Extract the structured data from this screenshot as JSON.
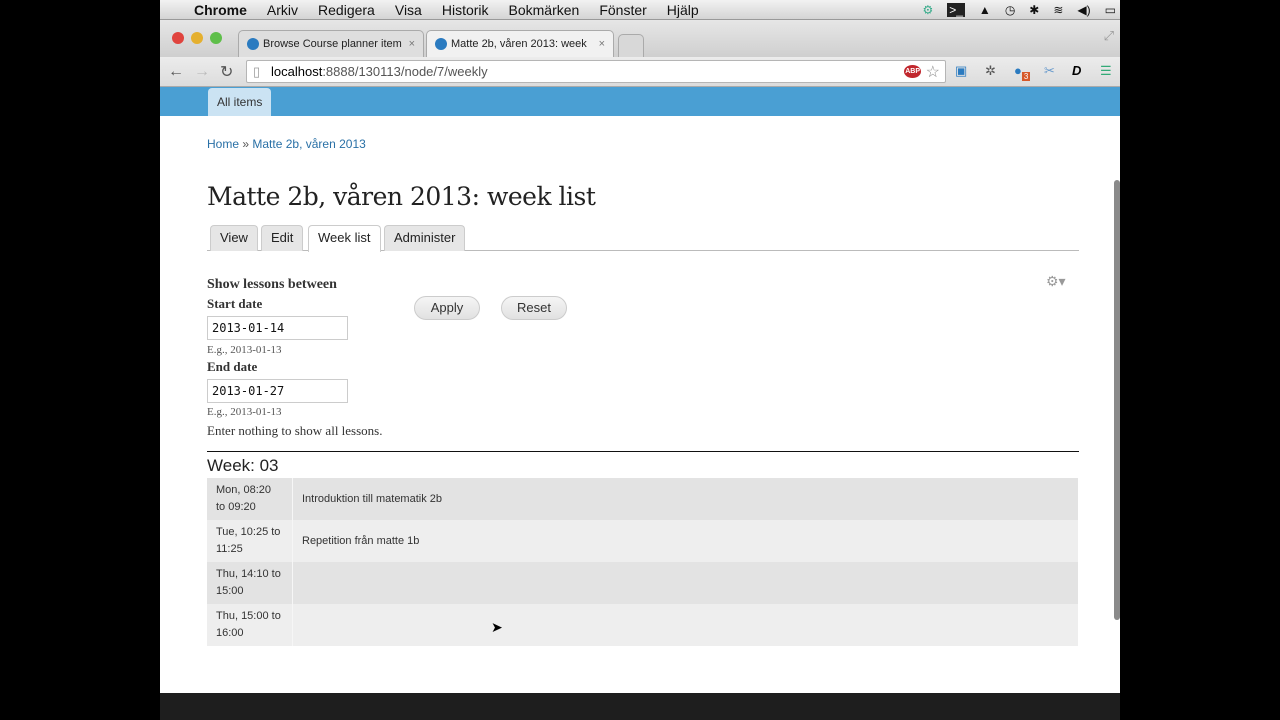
{
  "menubar": {
    "app": "Chrome",
    "items": [
      "Arkiv",
      "Redigera",
      "Visa",
      "Historik",
      "Bokmärken",
      "Fönster",
      "Hjälp"
    ]
  },
  "tabs": [
    {
      "label": "Browse Course planner item",
      "active": false
    },
    {
      "label": "Matte 2b, våren 2013: week",
      "active": true
    }
  ],
  "url": {
    "host": "localhost",
    "path": ":8888/130113/node/7/weekly"
  },
  "extensions": {
    "adblock": "ABP",
    "badge": "3"
  },
  "site_nav": {
    "all_items": "All items"
  },
  "breadcrumb": {
    "home": "Home",
    "sep": "»",
    "current": "Matte 2b, våren 2013"
  },
  "page_title": "Matte 2b, våren 2013: week list",
  "page_tabs": [
    {
      "label": "View"
    },
    {
      "label": "Edit"
    },
    {
      "label": "Week list",
      "active": true
    },
    {
      "label": "Administer"
    }
  ],
  "filter": {
    "heading": "Show lessons between",
    "start_label": "Start date",
    "start_value": "2013-01-14",
    "start_hint": "E.g., 2013-01-13",
    "end_label": "End date",
    "end_value": "2013-01-27",
    "end_hint": "E.g., 2013-01-13",
    "note": "Enter nothing to show all lessons.",
    "apply": "Apply",
    "reset": "Reset"
  },
  "week": {
    "title": "Week: 03",
    "lessons": [
      {
        "time": "Mon, 08:20 to 09:20",
        "title": "Introduktion till matematik 2b"
      },
      {
        "time": "Tue, 10:25 to 11:25",
        "title": "Repetition från matte 1b"
      },
      {
        "time": "Thu, 14:10 to 15:00",
        "title": ""
      },
      {
        "time": "Thu, 15:00 to 16:00",
        "title": ""
      }
    ]
  },
  "colors": {
    "brand_bar": "#4a9fd3",
    "link": "#2970a6"
  }
}
